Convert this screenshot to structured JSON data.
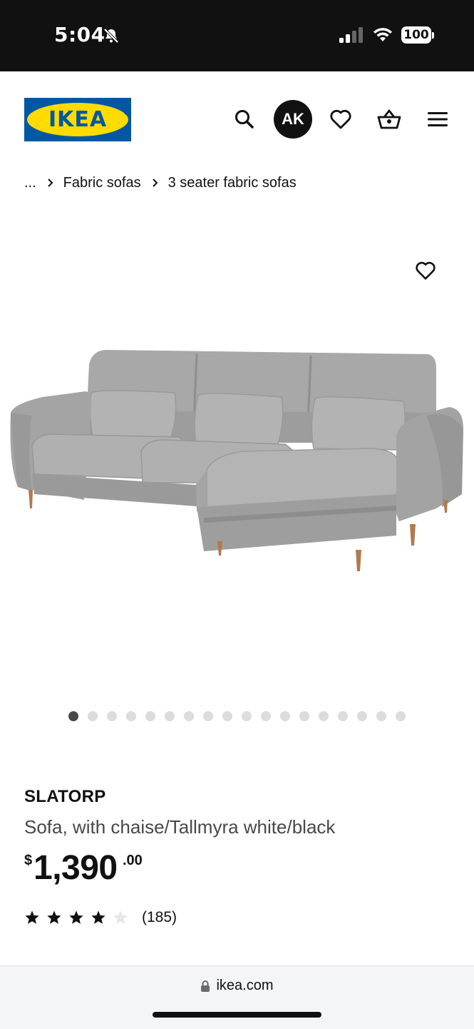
{
  "status_bar": {
    "time": "5:04",
    "battery": "100"
  },
  "header": {
    "logo_text": "IKEA",
    "avatar_initials": "AK",
    "icons": [
      "search-icon",
      "heart-icon",
      "shopping-basket-icon",
      "menu-icon"
    ]
  },
  "breadcrumb": {
    "ellipsis": "...",
    "items": [
      "Fabric sofas",
      "3 seater fabric sofas"
    ]
  },
  "gallery": {
    "image_count": 18,
    "active_index": 0
  },
  "product": {
    "name": "SLATORP",
    "description": "Sofa, with chaise/Tallmyra white/black",
    "price_currency": "$",
    "price_main": "1,390",
    "price_decimal": ".00",
    "rating": 4,
    "rating_max": 5,
    "review_count": "(185)"
  },
  "browser": {
    "url": "ikea.com"
  },
  "colors": {
    "brand_blue": "#0058a3",
    "brand_yellow": "#ffdb00",
    "sofa_gray": "#a9a9a9",
    "leg_wood": "#b07a4f"
  }
}
